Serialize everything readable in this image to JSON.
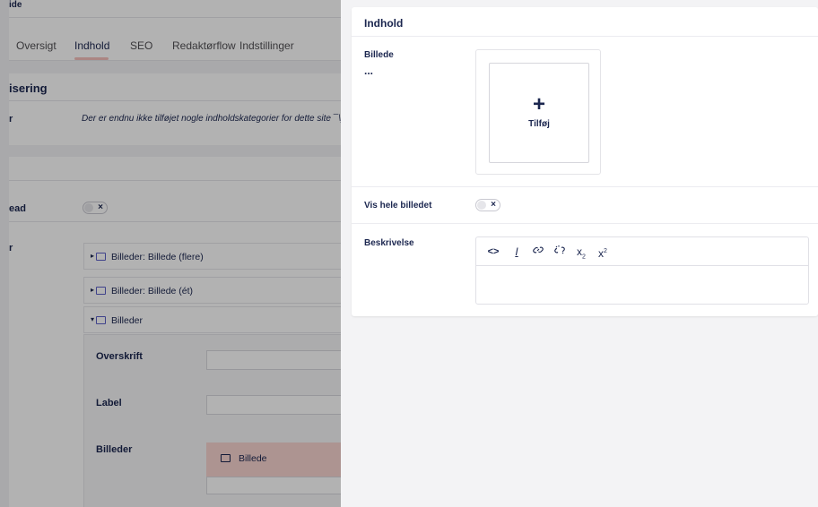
{
  "background": {
    "header_title": "ide",
    "tabs": [
      {
        "label": "Oversigt",
        "active": false
      },
      {
        "label": "Indhold",
        "active": true
      },
      {
        "label": "SEO",
        "active": false
      },
      {
        "label": "Redaktørflow",
        "active": false
      },
      {
        "label": "Indstillinger",
        "active": false
      }
    ],
    "section1_title": "isering",
    "section1_label": "r",
    "section1_empty": "Der er endnu ikke tilføjet nogle indholdskategorier for dette site ¯\\_(",
    "toggle_label": "ead",
    "blocks_label": "r",
    "blocks": [
      {
        "caret": "▸",
        "label": "Billeder: Billede (flere)"
      },
      {
        "caret": "▸",
        "label": "Billeder: Billede (ét)"
      },
      {
        "caret": "▾",
        "label": "Billeder"
      }
    ],
    "fields": {
      "overskrift": "Overskrift",
      "label": "Label",
      "billeder": "Billeder",
      "billede_item": "Billede"
    }
  },
  "panel": {
    "title": "Indhold",
    "image_field": {
      "label": "Billede",
      "dots": "...",
      "add_symbol": "+",
      "add_label": "Tilføj"
    },
    "toggle_field": {
      "label": "Vis hele billedet",
      "state_glyph": "×"
    },
    "description_field": {
      "label": "Beskrivelse",
      "toolbar": [
        {
          "name": "source-code-icon",
          "glyph": "<>"
        },
        {
          "name": "clear-format-icon",
          "glyph": "I"
        },
        {
          "name": "link-icon",
          "glyph": "🔗"
        },
        {
          "name": "unlink-icon",
          "glyph": "⛓"
        },
        {
          "name": "subscript-icon",
          "glyph": "x",
          "mark": "2"
        },
        {
          "name": "superscript-icon",
          "glyph": "x",
          "mark": "2"
        }
      ],
      "value": ""
    }
  },
  "colors": {
    "text": "#1b264f",
    "active_tab_underline": "#f5c1bc",
    "selected_item": "#f8d4d0",
    "panel_bg": "#f3f3f5"
  }
}
